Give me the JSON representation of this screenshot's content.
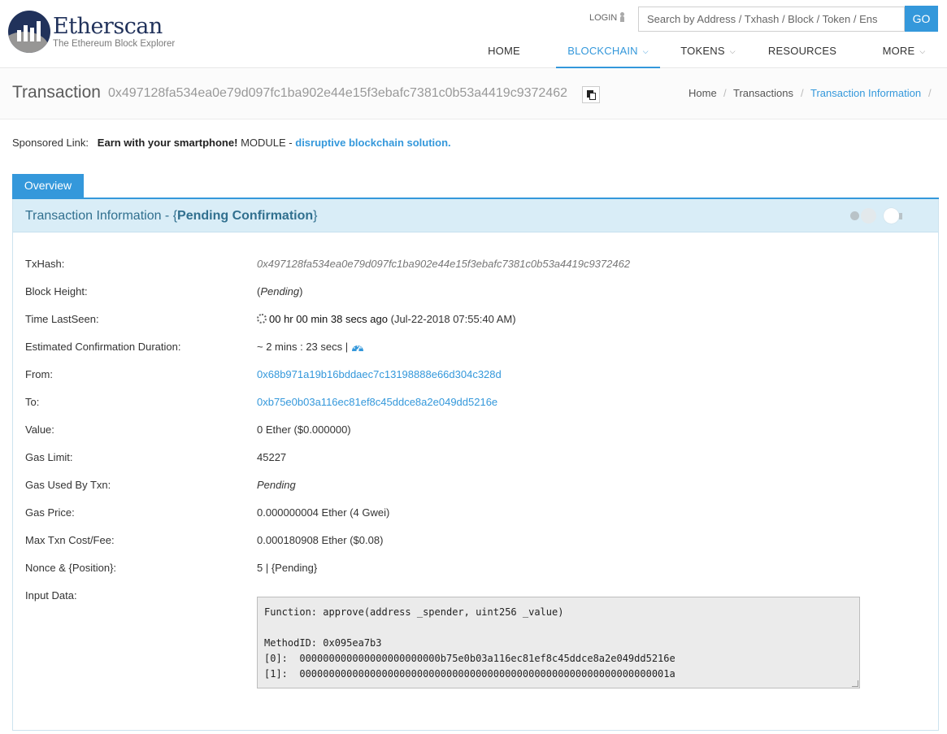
{
  "brand": {
    "name": "Etherscan",
    "tagline": "The Ethereum Block Explorer"
  },
  "header": {
    "login_label": "LOGIN",
    "search_placeholder": "Search by Address / Txhash / Block / Token / Ens",
    "go_label": "GO",
    "nav": [
      "HOME",
      "BLOCKCHAIN",
      "TOKENS",
      "RESOURCES",
      "MORE"
    ],
    "active_nav": "BLOCKCHAIN"
  },
  "titlebar": {
    "title": "Transaction",
    "hash": "0x497128fa534ea0e79d097fc1ba902e44e15f3ebafc7381c0b53a4419c9372462",
    "breadcrumb": [
      "Home",
      "Transactions",
      "Transaction Information"
    ],
    "breadcrumb_separator": "/"
  },
  "sponsor": {
    "label": "Sponsored Link:",
    "bold": "Earn with your smartphone!",
    "text": "MODULE -",
    "link": "disruptive blockchain solution."
  },
  "tabs": [
    "Overview"
  ],
  "panel": {
    "title_prefix": "Transaction Information - {",
    "title_status": "Pending Confirmation",
    "title_suffix": "}"
  },
  "details": {
    "txhash": {
      "label": "TxHash:",
      "value": "0x497128fa534ea0e79d097fc1ba902e44e15f3ebafc7381c0b53a4419c9372462"
    },
    "block_height": {
      "label": "Block Height:",
      "open": "(",
      "value": "Pending",
      "close": ")"
    },
    "time_lastseen": {
      "label": "Time LastSeen:",
      "value": "00 hr 00 min 38 secs ago",
      "date": "(Jul-22-2018 07:55:40 AM)"
    },
    "est_confirmation": {
      "label": "Estimated Confirmation Duration:",
      "value": "~ 2 mins : 23 secs |"
    },
    "from": {
      "label": "From:",
      "value": "0x68b971a19b16bddaec7c13198888e66d304c328d"
    },
    "to": {
      "label": "To:",
      "value": "0xb75e0b03a116ec81ef8c45ddce8a2e049dd5216e"
    },
    "value": {
      "label": "Value:",
      "value": "0 Ether ($0.000000)"
    },
    "gas_limit": {
      "label": "Gas Limit:",
      "value": "45227"
    },
    "gas_used": {
      "label": "Gas Used By Txn:",
      "value": "Pending"
    },
    "gas_price": {
      "label": "Gas Price:",
      "value": "0.000000004 Ether (4 Gwei)"
    },
    "max_fee": {
      "label": "Max Txn Cost/Fee:",
      "value": "0.000180908 Ether ($0.08)"
    },
    "nonce": {
      "label": "Nonce & {Position}:",
      "value": "5 | {Pending}"
    },
    "input_data": {
      "label": "Input Data:",
      "value": "Function: approve(address _spender, uint256 _value)\n\nMethodID: 0x095ea7b3\n[0]:  000000000000000000000000b75e0b03a116ec81ef8c45ddce8a2e049dd5216e\n[1]:  000000000000000000000000000000000000000000000000000000000000001a"
    }
  },
  "colors": {
    "accent": "#3498db",
    "panel_header": "#d9edf7",
    "panel_title": "#31708f",
    "logo_dark": "#21325b"
  }
}
